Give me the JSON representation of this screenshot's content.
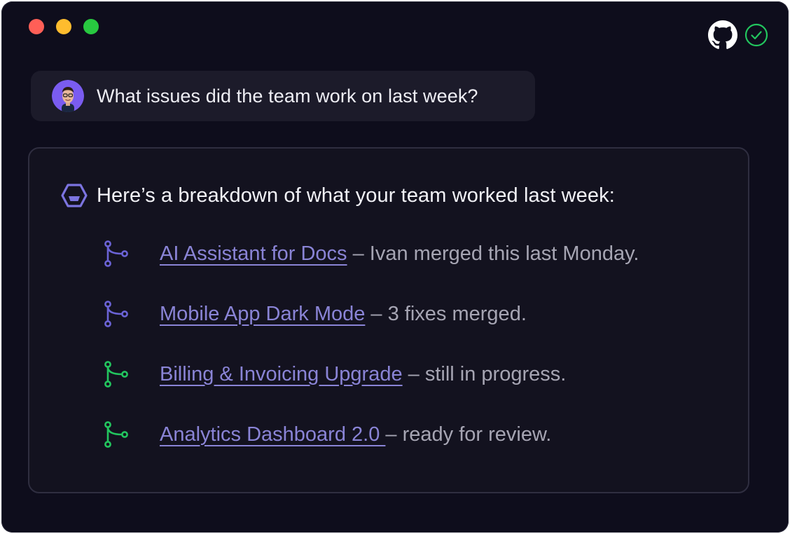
{
  "window": {
    "controls": [
      "close",
      "minimize",
      "zoom"
    ]
  },
  "status": {
    "github_icon": "github-icon",
    "check_icon": "check-circle-icon",
    "check_color": "#22c55e"
  },
  "user_message": {
    "avatar_icon": "avatar",
    "text": "What issues did the team work on last week?"
  },
  "assistant": {
    "icon": "assistant-logo-icon",
    "intro": "Here’s a breakdown of what your team worked last week:",
    "items": [
      {
        "title": "AI Assistant for Docs",
        "desc": " – Ivan merged this last Monday.",
        "icon": "git-merge-icon",
        "color": "#6b63d6"
      },
      {
        "title": "Mobile App Dark Mode",
        "desc": " – 3 fixes merged.",
        "icon": "git-merge-icon",
        "color": "#6b63d6"
      },
      {
        "title": "Billing & Invoicing Upgrade",
        "desc": " – still in progress.",
        "icon": "git-branch-icon",
        "color": "#22c55e"
      },
      {
        "title": "Analytics Dashboard 2.0 ",
        "desc": "– ready for review.",
        "icon": "git-branch-icon",
        "color": "#22c55e"
      }
    ]
  },
  "colors": {
    "background": "#0e0d1c",
    "link": "#8a84d6",
    "muted_text": "#a6a5b3"
  }
}
